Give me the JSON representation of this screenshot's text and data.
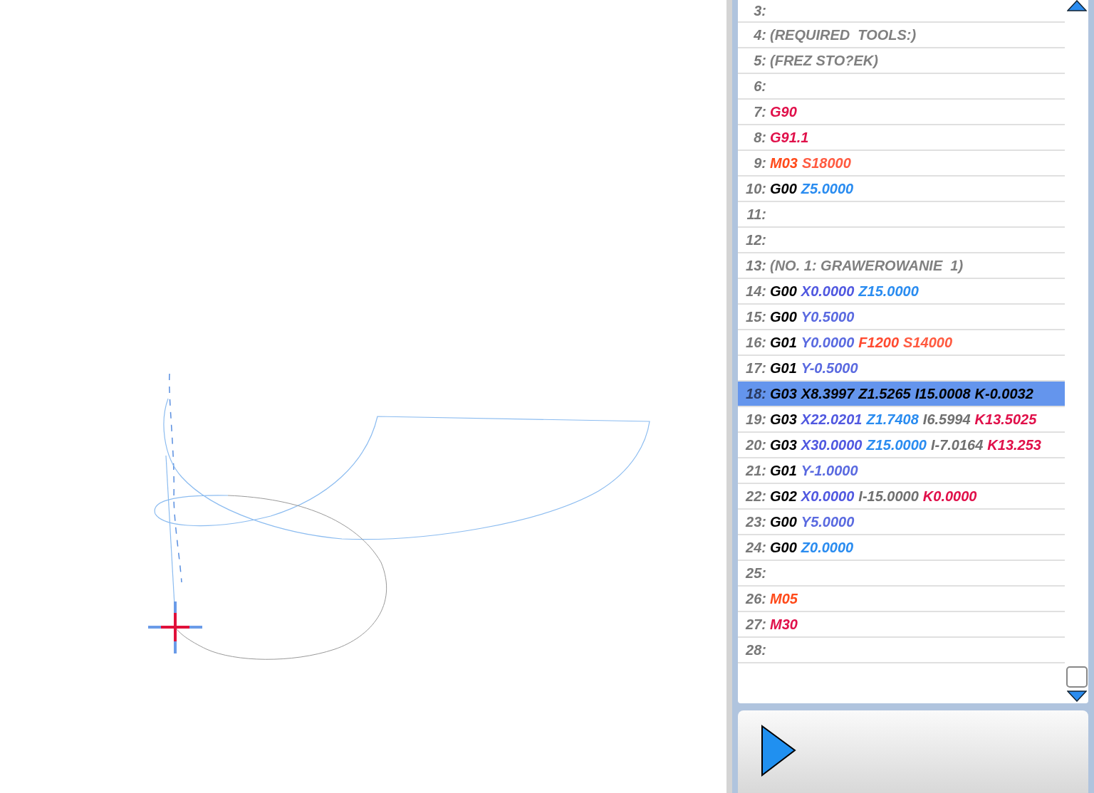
{
  "code_lines": [
    {
      "number": "3:",
      "selected": false
    },
    {
      "number": "4:",
      "selected": false,
      "tokens": [
        {
          "text": "(REQUIRED  TOOLS:)",
          "color": "#808080"
        }
      ]
    },
    {
      "number": "5:",
      "selected": false,
      "tokens": [
        {
          "text": "(FREZ STO?EK)",
          "color": "#808080"
        }
      ]
    },
    {
      "number": "6:",
      "selected": false
    },
    {
      "number": "7:",
      "selected": false,
      "tokens": [
        {
          "text": "G90",
          "color": "#e0104a"
        }
      ]
    },
    {
      "number": "8:",
      "selected": false,
      "tokens": [
        {
          "text": "G91.1",
          "color": "#e0104a"
        }
      ]
    },
    {
      "number": "9:",
      "selected": false,
      "tokens": [
        {
          "text": "M03",
          "color": "#ff4a1a"
        },
        {
          "text": "S18000",
          "color": "#ff5a40"
        }
      ]
    },
    {
      "number": "10:",
      "selected": false,
      "tokens": [
        {
          "text": "G00",
          "color": "#000000"
        },
        {
          "text": "Z5.0000",
          "color": "#2a8cf0"
        }
      ]
    },
    {
      "number": "11:",
      "selected": false
    },
    {
      "number": "12:",
      "selected": false
    },
    {
      "number": "13:",
      "selected": false,
      "tokens": [
        {
          "text": "(NO. 1: GRAWEROWANIE  1)",
          "color": "#808080"
        }
      ]
    },
    {
      "number": "14:",
      "selected": false,
      "tokens": [
        {
          "text": "G00",
          "color": "#000000"
        },
        {
          "text": "X0.0000",
          "color": "#5058e0"
        },
        {
          "text": "Z15.0000",
          "color": "#2a8cf0"
        }
      ]
    },
    {
      "number": "15:",
      "selected": false,
      "tokens": [
        {
          "text": "G00",
          "color": "#000000"
        },
        {
          "text": "Y0.5000",
          "color": "#5a6ae0"
        }
      ]
    },
    {
      "number": "16:",
      "selected": false,
      "tokens": [
        {
          "text": "G01",
          "color": "#000000"
        },
        {
          "text": "Y0.0000",
          "color": "#5a6ae0"
        },
        {
          "text": "F1200",
          "color": "#ff4a30"
        },
        {
          "text": "S14000",
          "color": "#ff5a40"
        }
      ]
    },
    {
      "number": "17:",
      "selected": false,
      "tokens": [
        {
          "text": "G01",
          "color": "#000000"
        },
        {
          "text": "Y-0.5000",
          "color": "#5a6ae0"
        }
      ]
    },
    {
      "number": "18:",
      "selected": true,
      "tokens": [
        {
          "text": "G03",
          "color": "#000000"
        },
        {
          "text": "X8.3997",
          "color": "#000000"
        },
        {
          "text": "Z1.5265",
          "color": "#000000"
        },
        {
          "text": "I15.0008",
          "color": "#000000"
        },
        {
          "text": "K-0.0032",
          "color": "#000000"
        }
      ]
    },
    {
      "number": "19:",
      "selected": false,
      "tokens": [
        {
          "text": "G03",
          "color": "#000000"
        },
        {
          "text": "X22.0201",
          "color": "#5058e0"
        },
        {
          "text": "Z1.7408",
          "color": "#2a8cf0"
        },
        {
          "text": "I6.5994",
          "color": "#707070"
        },
        {
          "text": "K13.5025",
          "color": "#e0104a"
        }
      ]
    },
    {
      "number": "20:",
      "selected": false,
      "tokens": [
        {
          "text": "G03",
          "color": "#000000"
        },
        {
          "text": "X30.0000",
          "color": "#5058e0"
        },
        {
          "text": "Z15.0000",
          "color": "#2a8cf0"
        },
        {
          "text": "I-7.0164",
          "color": "#707070"
        },
        {
          "text": "K13.253",
          "color": "#e0104a"
        }
      ]
    },
    {
      "number": "21:",
      "selected": false,
      "tokens": [
        {
          "text": "G01",
          "color": "#000000"
        },
        {
          "text": "Y-1.0000",
          "color": "#5a6ae0"
        }
      ]
    },
    {
      "number": "22:",
      "selected": false,
      "tokens": [
        {
          "text": "G02",
          "color": "#000000"
        },
        {
          "text": "X0.0000",
          "color": "#5058e0"
        },
        {
          "text": "I-15.0000",
          "color": "#707070"
        },
        {
          "text": "K0.0000",
          "color": "#e0104a"
        }
      ]
    },
    {
      "number": "23:",
      "selected": false,
      "tokens": [
        {
          "text": "G00",
          "color": "#000000"
        },
        {
          "text": "Y5.0000",
          "color": "#5a6ae0"
        }
      ]
    },
    {
      "number": "24:",
      "selected": false,
      "tokens": [
        {
          "text": "G00",
          "color": "#000000"
        },
        {
          "text": "Z0.0000",
          "color": "#2a8cf0"
        }
      ]
    },
    {
      "number": "25:",
      "selected": false
    },
    {
      "number": "26:",
      "selected": false,
      "tokens": [
        {
          "text": "M05",
          "color": "#ff4a1a"
        }
      ]
    },
    {
      "number": "27:",
      "selected": false,
      "tokens": [
        {
          "text": "M30",
          "color": "#e0104a"
        }
      ]
    },
    {
      "number": "28:",
      "selected": false
    }
  ]
}
